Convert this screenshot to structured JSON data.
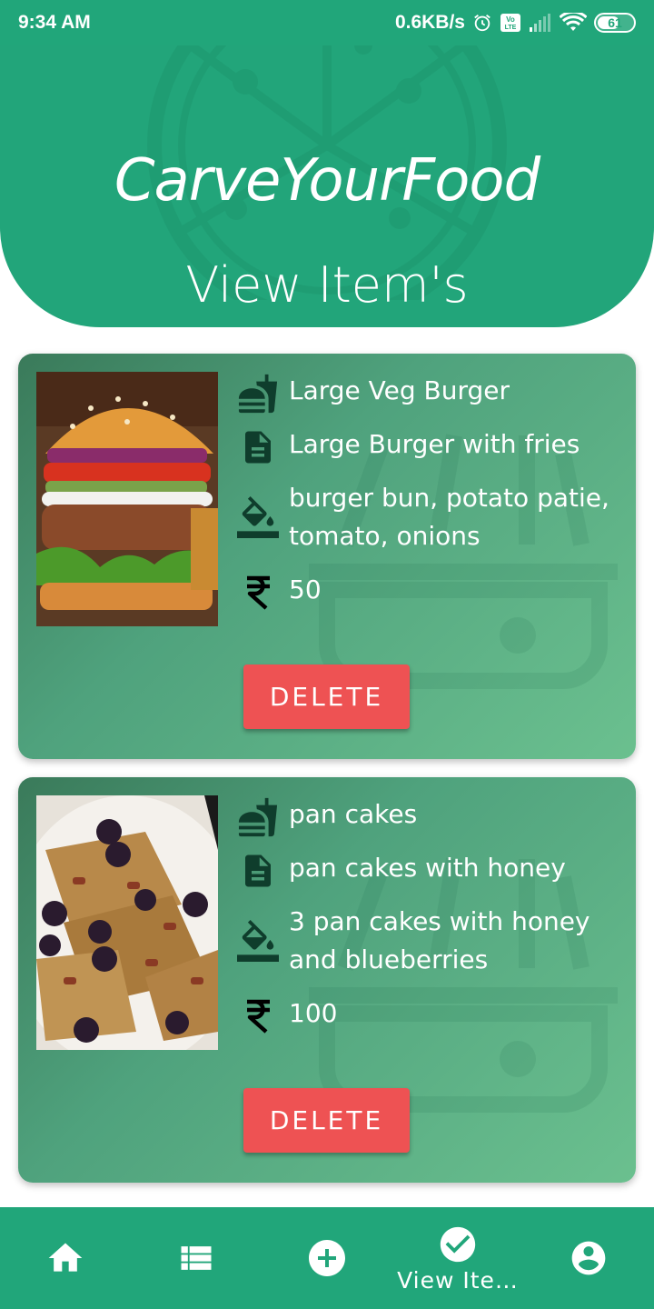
{
  "status_bar": {
    "time": "9:34 AM",
    "network_speed": "0.6KB/s",
    "battery_level": "61",
    "icons": [
      "alarm-icon",
      "volte-icon",
      "signal-icon",
      "wifi-icon",
      "battery-icon"
    ]
  },
  "header": {
    "app_title": "CarveYourFood",
    "page_title": "View Item's"
  },
  "items": [
    {
      "name": "Large Veg Burger",
      "description": "Large Burger with fries",
      "ingredients": "burger bun, potato patie, tomato, onions",
      "price": "50",
      "delete_label": "DELETE"
    },
    {
      "name": "pan cakes",
      "description": "pan cakes with honey",
      "ingredients": "3 pan cakes with honey and blueberries",
      "price": "100",
      "delete_label": "DELETE"
    }
  ],
  "bottom_nav": {
    "items": [
      {
        "icon": "home-icon",
        "label": ""
      },
      {
        "icon": "list-icon",
        "label": ""
      },
      {
        "icon": "add-circle-icon",
        "label": ""
      },
      {
        "icon": "check-circle-icon",
        "label": "View Ite…"
      },
      {
        "icon": "account-icon",
        "label": ""
      }
    ]
  },
  "colors": {
    "primary": "#21a67a",
    "delete": "#ee5253",
    "card_gradient_start": "#3a7a5a",
    "card_gradient_end": "#6bc08f"
  }
}
